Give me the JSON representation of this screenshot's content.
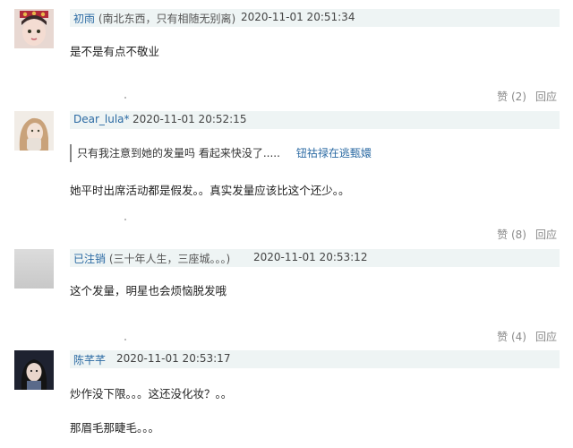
{
  "comments": [
    {
      "username": "初雨",
      "note": "(南北东西，只有相随无别离)",
      "time": "2020-11-01 20:51:34",
      "lines": [
        "是不是有点不敬业"
      ],
      "likes_label": "赞 (2)",
      "reply_label": "回应"
    },
    {
      "username": "Dear_lula*",
      "note": "",
      "time": "2020-11-01 20:52:15",
      "quote": {
        "text": "只有我注意到她的发量吗 看起来快没了.....",
        "source": "钮祜禄在逃甄嬛"
      },
      "lines": [
        "她平时出席活动都是假发。。真实发量应该比这个还少。。"
      ],
      "likes_label": "赞 (8)",
      "reply_label": "回应"
    },
    {
      "username": "已注销",
      "note": "(三十年人生，三座城。。。)",
      "time": "2020-11-01 20:53:12",
      "lines": [
        "这个发量，明星也会烦恼脱发哦"
      ],
      "likes_label": "赞 (4)",
      "reply_label": "回应"
    },
    {
      "username": "陈芊芊",
      "note": "",
      "time": "2020-11-01 20:53:17",
      "lines": [
        "炒作没下限。。。这还没化妆？。。",
        "那眉毛那睫毛。。。"
      ]
    }
  ],
  "colors": {
    "link": "#2b6aa3",
    "header_bg": "#eef4f4",
    "meta": "#888888"
  }
}
